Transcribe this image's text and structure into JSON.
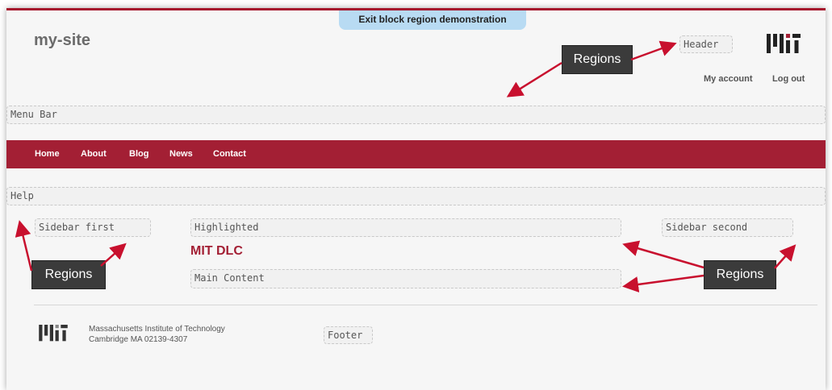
{
  "demo_banner": "Exit block region demonstration",
  "site_name": "my-site",
  "regions": {
    "header": "Header",
    "menu_bar": "Menu Bar",
    "help": "Help",
    "sidebar_first": "Sidebar first",
    "highlighted": "Highlighted",
    "sidebar_second": "Sidebar second",
    "main_content": "Main Content",
    "footer": "Footer"
  },
  "user_menu": {
    "my_account": "My account",
    "log_out": "Log out"
  },
  "main_nav": [
    "Home",
    "About",
    "Blog",
    "News",
    "Contact"
  ],
  "block_title": "MIT DLC",
  "footer": {
    "line1": "Massachusetts Institute of Technology",
    "line2": "Cambridge MA 02139-4307"
  },
  "callouts": [
    "Regions",
    "Regions",
    "Regions"
  ],
  "icons": [
    "mit-logo-icon"
  ],
  "colors": {
    "brand_red": "#a31f34",
    "banner_blue": "#b8dbf3",
    "callout_bg": "#3b3b3b",
    "arrow_red": "#c8102e"
  }
}
